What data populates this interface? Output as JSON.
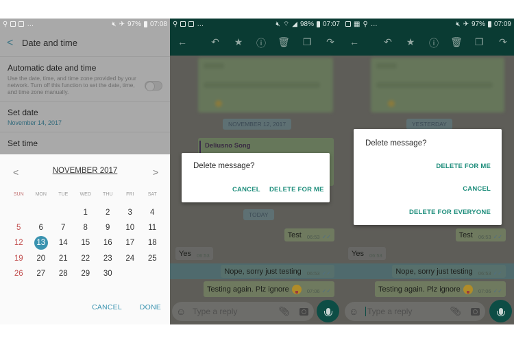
{
  "settings_screen": {
    "status_bar": {
      "left_icons": [
        "usb-icon",
        "image-icon",
        "clipboard-icon",
        "more-icon"
      ],
      "battery": "97%",
      "time": "07:08"
    },
    "header": {
      "back_label": "<",
      "title": "Date and time"
    },
    "rows": [
      {
        "title": "Automatic date and time",
        "description": "Use the date, time, and time zone provided by your network. Turn off this function to set the date, time, and time zone manually.",
        "toggle_on": false
      },
      {
        "title": "Set date",
        "value": "November 14, 2017"
      },
      {
        "title": "Set time"
      }
    ],
    "calendar": {
      "month_label": "NOVEMBER 2017",
      "prev_label": "<",
      "next_label": ">",
      "weekdays": [
        "SUN",
        "MON",
        "TUE",
        "WED",
        "THU",
        "FRI",
        "SAT"
      ],
      "first_weekday_index": 3,
      "days_in_month": 30,
      "selected_day": 13,
      "cancel_label": "CANCEL",
      "done_label": "DONE",
      "accent_color": "#3a93b0"
    }
  },
  "chat_screen_1": {
    "status_bar": {
      "battery": "98%",
      "time": "07:07"
    },
    "date_chips": [
      "NOVEMBER 12, 2017",
      "TODAY"
    ],
    "quoted_sender": "Deliusno Song",
    "messages": [
      {
        "text": "Test",
        "time": "06:53",
        "direction": "out",
        "ticks": "✓✓"
      },
      {
        "text": "Yes",
        "time": "06:53",
        "direction": "in"
      },
      {
        "text": "Nope, sorry just testing",
        "time": "06:53",
        "direction": "out",
        "ticks": "✓✓",
        "selected": true
      },
      {
        "text": "Testing again. Plz ignore",
        "time": "07:06",
        "direction": "out",
        "ticks": "✓✓",
        "emoji": "tongue-face"
      }
    ],
    "input_placeholder": "Type a reply",
    "dialog": {
      "title": "Delete message?",
      "buttons": [
        "CANCEL",
        "DELETE FOR ME"
      ]
    }
  },
  "chat_screen_2": {
    "status_bar": {
      "battery": "97%",
      "time": "07:09"
    },
    "date_chips": [
      "YESTERDAY"
    ],
    "messages": [
      {
        "text": "Test",
        "time": "06:53",
        "direction": "out",
        "ticks": "✓✓"
      },
      {
        "text": "Yes",
        "time": "06:53",
        "direction": "in"
      },
      {
        "text": "Nope, sorry just testing",
        "time": "06:53",
        "direction": "out",
        "ticks": "✓✓",
        "selected": true
      },
      {
        "text": "Testing again. Plz ignore",
        "time": "07:06",
        "direction": "out",
        "ticks": "✓✓",
        "emoji": "tongue-face"
      }
    ],
    "input_placeholder": "Type a reply",
    "dialog": {
      "title": "Delete message?",
      "buttons": [
        "DELETE FOR ME",
        "CANCEL",
        "DELETE FOR EVERYONE"
      ]
    }
  },
  "action_bar_icons": [
    "back-arrow-icon",
    "reply-icon",
    "star-icon",
    "info-icon",
    "delete-icon",
    "copy-icon",
    "forward-icon"
  ],
  "theme": {
    "whatsapp_dark": "#0a3b33",
    "dialog_button": "#1f8e7c",
    "fab": "#0d4d45"
  }
}
